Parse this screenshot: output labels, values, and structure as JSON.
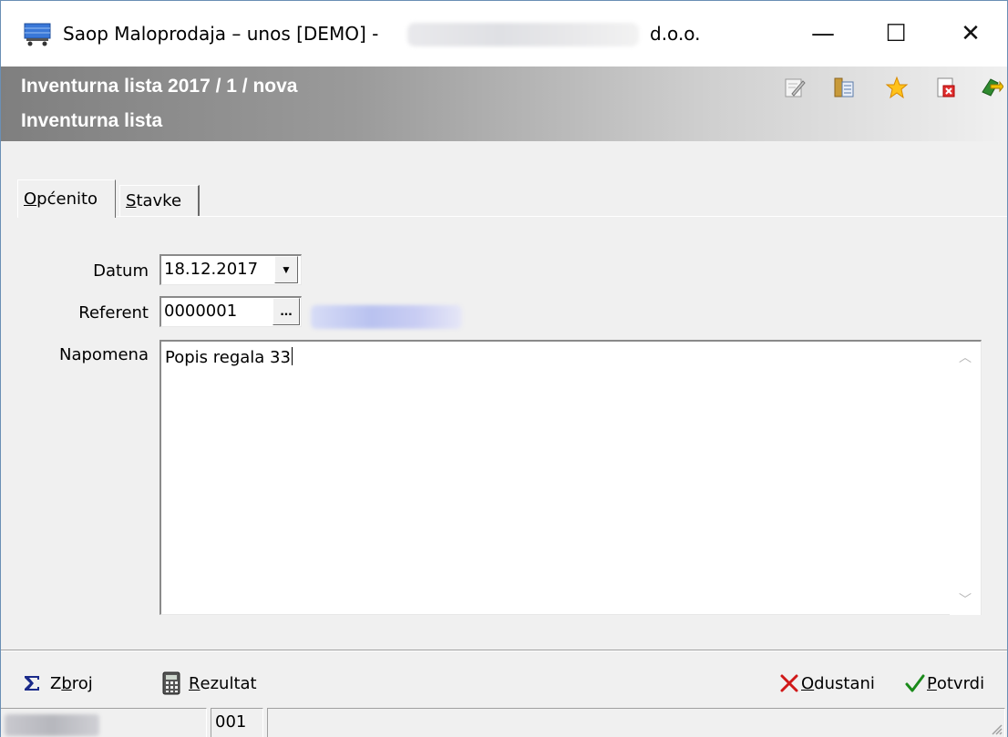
{
  "window": {
    "title": "Saop Maloprodaja – unos [DEMO] -",
    "title_suffix": "d.o.o.",
    "controls": {
      "minimize": "—",
      "maximize": "☐",
      "close": "✕"
    }
  },
  "header": {
    "line1": "Inventurna lista 2017 / 1 / nova",
    "line2": "Inventurna lista",
    "toolbar_icons": [
      "edit-icon",
      "columns-icon",
      "star-icon",
      "delete-icon",
      "exit-icon"
    ]
  },
  "tabs": [
    {
      "prefix": "",
      "accel": "O",
      "rest": "pćenito",
      "active": true
    },
    {
      "prefix": "",
      "accel": "S",
      "rest": "tavke",
      "active": false
    }
  ],
  "form": {
    "datum_label": "Datum",
    "datum_value": "18.12.2017",
    "referent_label": "Referent",
    "referent_value": "0000001",
    "referent_button": "...",
    "napomena_label": "Napomena",
    "napomena_value": "Popis regala 33"
  },
  "buttons": {
    "zbroj": {
      "before": "Z",
      "accel": "b",
      "after": "roj"
    },
    "rezultat": {
      "before": "",
      "accel": "R",
      "after": "ezultat"
    },
    "odustani": {
      "before": "",
      "accel": "O",
      "after": "dustani"
    },
    "potvrdi": {
      "before": "",
      "accel": "P",
      "after": "otvrdi"
    }
  },
  "statusbar": {
    "pane2": "001"
  }
}
